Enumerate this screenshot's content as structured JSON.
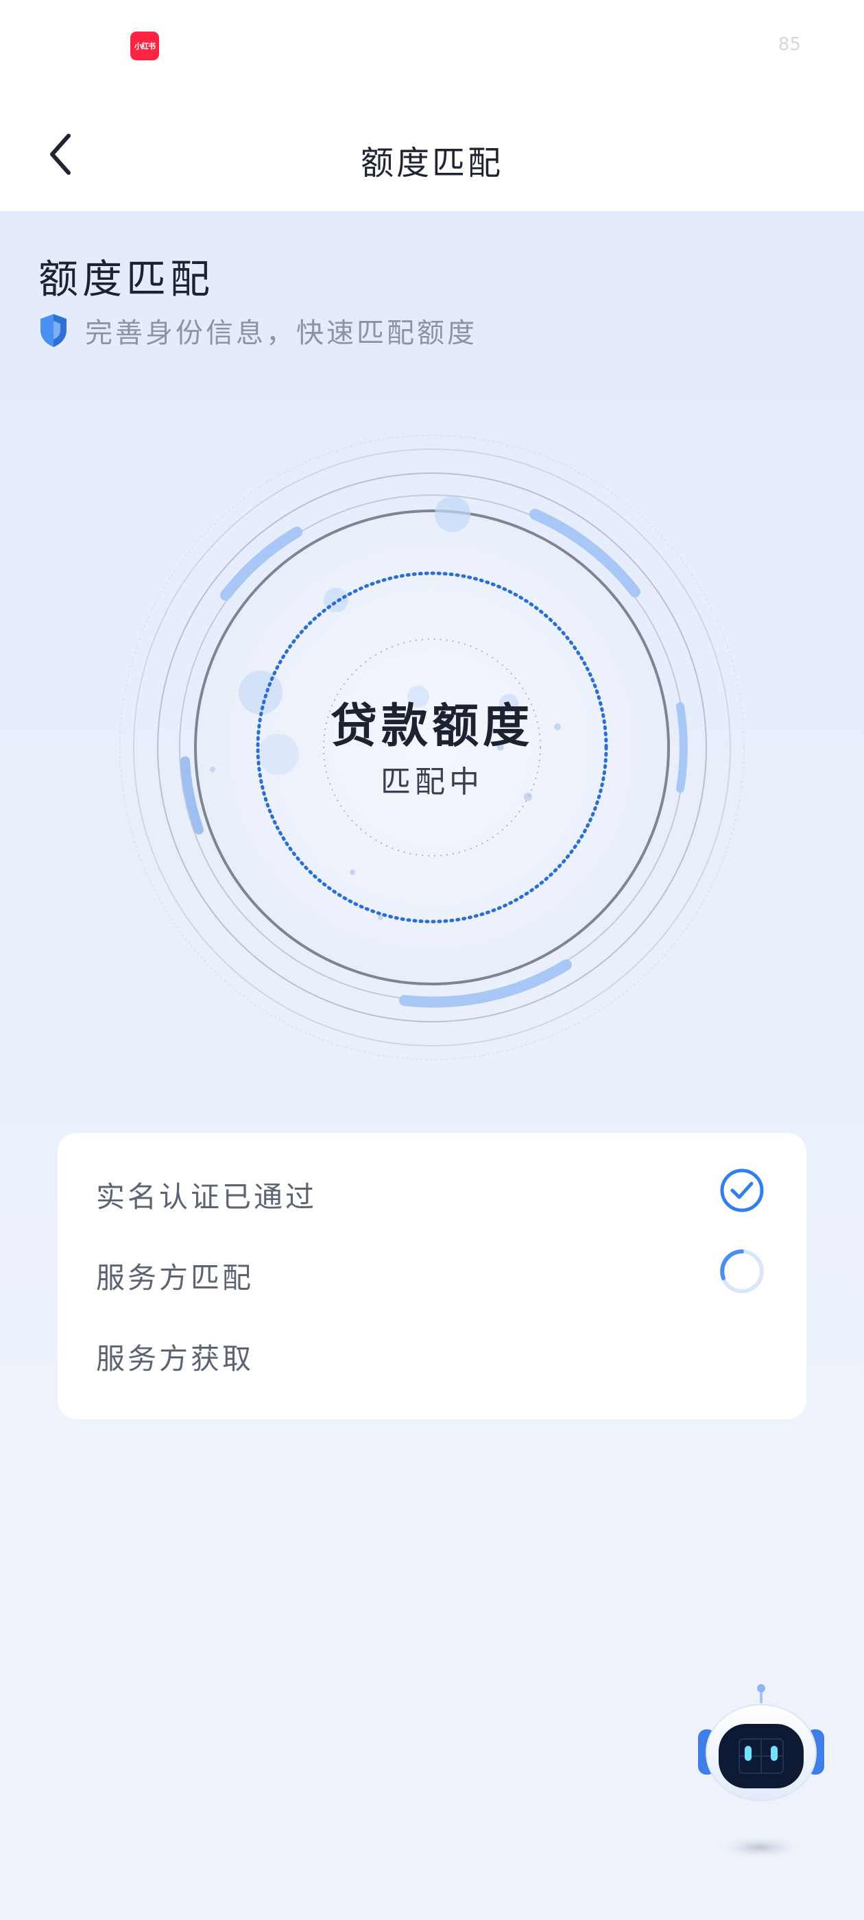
{
  "status_bar": {
    "app_badge": "小红书",
    "battery": "85"
  },
  "nav": {
    "title": "额度匹配"
  },
  "header": {
    "title": "额度匹配",
    "subtitle": "完善身份信息，快速匹配额度"
  },
  "ring": {
    "title": "贷款额度",
    "status": "匹配中"
  },
  "steps": [
    {
      "label": "实名认证已通过",
      "state": "done"
    },
    {
      "label": "服务方匹配",
      "state": "loading"
    },
    {
      "label": "服务方获取",
      "state": "pending"
    }
  ],
  "colors": {
    "accent": "#2f7ff0",
    "ring_dots": "#2a6fd6",
    "background": "#e8effb",
    "badge": "#ff2442"
  },
  "icons": {
    "back": "chevron-left-icon",
    "shield": "shield-icon",
    "check": "check-circle-icon",
    "spinner": "spinner-icon",
    "robot": "robot-assistant-icon"
  }
}
